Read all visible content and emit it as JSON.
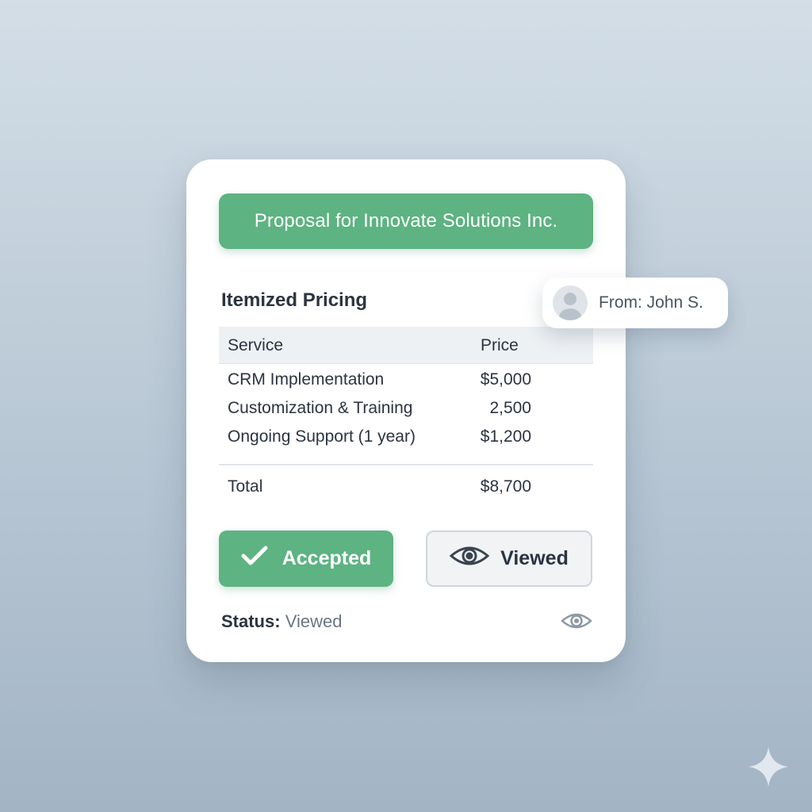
{
  "proposal": {
    "title": "Proposal for Innovate Solutions Inc."
  },
  "pricing": {
    "heading": "Itemized Pricing",
    "columns": {
      "service": "Service",
      "price": "Price"
    },
    "rows": [
      {
        "service": "CRM Implementation",
        "price": "$5,000"
      },
      {
        "service": "Customization & Training",
        "price": "2,500"
      },
      {
        "service": "Ongoing Support (1 year)",
        "price": "$1,200"
      }
    ],
    "total": {
      "label": "Total",
      "value": "$8,700"
    }
  },
  "actions": {
    "accepted_label": "Accepted",
    "accepted_icon": "checkmark-icon",
    "viewed_label": "Viewed",
    "viewed_icon": "eye-icon"
  },
  "status": {
    "label": "Status:",
    "value": "Viewed",
    "icon": "eye-icon"
  },
  "sender": {
    "text": "From: John S.",
    "avatar_icon": "user-avatar-icon"
  },
  "colors": {
    "accent_green": "#5db381",
    "text_dark": "#2b3440",
    "background_top": "#d3dee7",
    "background_bottom": "#a3b4c5"
  },
  "decoration": {
    "corner_icon": "sparkle-icon"
  }
}
